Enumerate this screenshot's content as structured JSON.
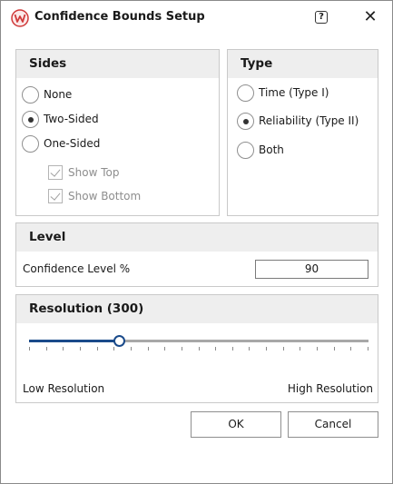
{
  "window": {
    "title": "Confidence Bounds Setup",
    "help_glyph": "?",
    "close_glyph": "✕"
  },
  "sides": {
    "header": "Sides",
    "options": [
      {
        "label": "None",
        "checked": false
      },
      {
        "label": "Two-Sided",
        "checked": true
      },
      {
        "label": "One-Sided",
        "checked": false
      }
    ],
    "show_top": {
      "label": "Show Top",
      "checked": true,
      "enabled": false
    },
    "show_bottom": {
      "label": "Show Bottom",
      "checked": true,
      "enabled": false
    }
  },
  "type": {
    "header": "Type",
    "options": [
      {
        "label": "Time (Type I)",
        "checked": false
      },
      {
        "label": "Reliability (Type II)",
        "checked": true
      },
      {
        "label": "Both",
        "checked": false
      }
    ]
  },
  "level": {
    "header": "Level",
    "label": "Confidence Level %",
    "value": "90"
  },
  "resolution": {
    "header": "Resolution (300)",
    "slider_fraction": 0.265,
    "tick_count": 21,
    "low_label": "Low Resolution",
    "high_label": "High Resolution"
  },
  "buttons": {
    "ok": "OK",
    "cancel": "Cancel"
  },
  "colors": {
    "accent": "#1a4a8a",
    "logo_red": "#d03a3a"
  }
}
